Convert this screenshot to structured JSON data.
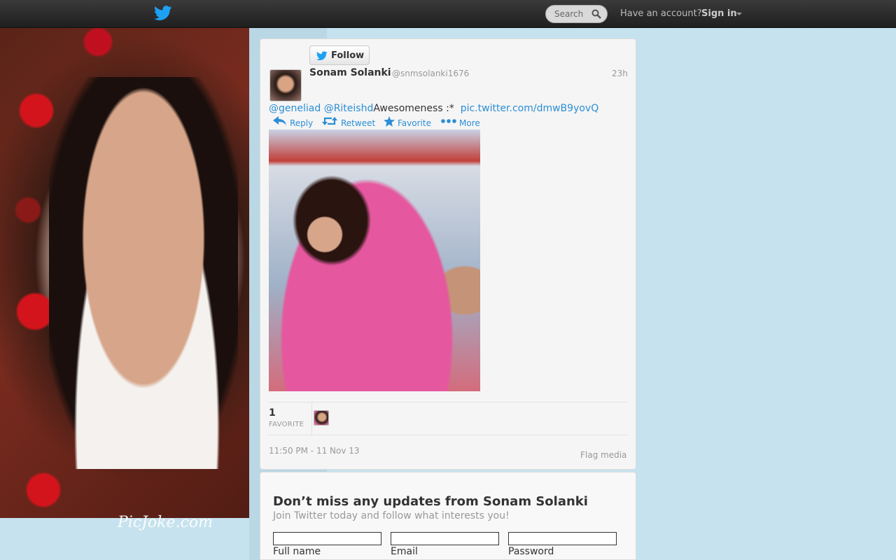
{
  "topbar": {
    "search_placeholder": "Search",
    "account_prompt": "Have an account?",
    "signin_label": "Sign in"
  },
  "background": {
    "watermark": "PicJoke.com"
  },
  "tweet": {
    "follow_label": "Follow",
    "author_name": "Sonam Solanki",
    "author_handle": "@snmsolanki1676",
    "age": "23h",
    "mention1": "@geneliad",
    "mention2": "@Riteishd",
    "text": "Awesomeness :*",
    "link": "pic.twitter.com/dmwB9yovQ",
    "actions": {
      "reply": "Reply",
      "retweet": "Retweet",
      "favorite": "Favorite",
      "more": "More"
    },
    "favorite_count": "1",
    "favorite_label": "FAVORITE",
    "timestamp": "11:50 PM - 11 Nov 13",
    "flag_label": "Flag media"
  },
  "signup": {
    "title": "Don’t miss any updates from Sonam Solanki",
    "subtitle": "Join Twitter today and follow what interests you!",
    "fields": {
      "full_name": "Full name",
      "email": "Email",
      "password": "Password"
    }
  },
  "colors": {
    "link": "#2a8ed6",
    "topbar": "#2b2b2b",
    "page_bg": "#c6e2ee",
    "twitter_blue": "#1da1f2"
  },
  "icons": [
    "twitter-bird-icon",
    "search-icon",
    "caret-down-icon",
    "reply-icon",
    "retweet-icon",
    "star-icon",
    "more-dots-icon"
  ]
}
